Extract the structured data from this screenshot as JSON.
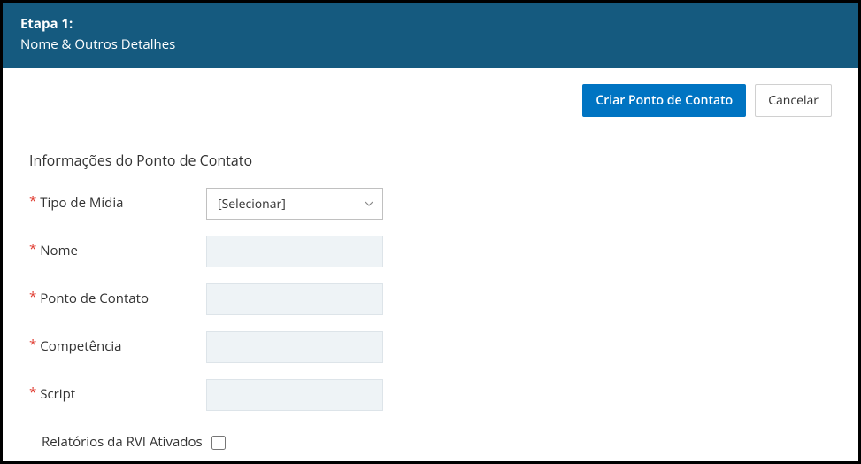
{
  "header": {
    "title": "Etapa 1:",
    "subtitle": "Nome & Outros Detalhes"
  },
  "actions": {
    "primary": "Criar Ponto de Contato",
    "secondary": "Cancelar"
  },
  "section": {
    "title": "Informações do Ponto de Contato"
  },
  "form": {
    "media_type": {
      "label": "Tipo de Mídia",
      "placeholder": "[Selecionar]"
    },
    "name": {
      "label": "Nome",
      "value": ""
    },
    "point_of_contact": {
      "label": "Ponto de Contato",
      "value": ""
    },
    "competence": {
      "label": "Competência",
      "value": ""
    },
    "script": {
      "label": "Script",
      "value": ""
    },
    "rvi_reports": {
      "label": "Relatórios da RVI Ativados",
      "checked": false
    }
  }
}
